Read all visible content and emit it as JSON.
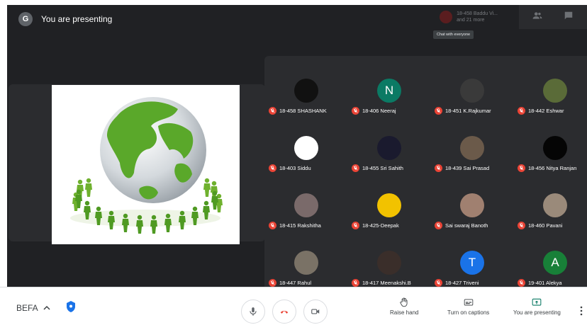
{
  "header": {
    "avatar_letter": "G",
    "title": "You are presenting"
  },
  "presenter_chip": {
    "line1": "18-458 Baddu Vi...",
    "line2": "and 21 more"
  },
  "tooltip": "Chat with everyone",
  "participants": [
    {
      "name": "18-458 SHASHANK",
      "avatar_color": "#111111"
    },
    {
      "name": "18-406 Neeraj",
      "avatar_letter": "N",
      "avatar_color": "#0b7a64"
    },
    {
      "name": "18-451 K.Rajkumar",
      "avatar_color": "#3a3a3a"
    },
    {
      "name": "18-442 Eshwar",
      "avatar_color": "#5a6b38"
    },
    {
      "name": "18-403 Siddu",
      "avatar_color": "#ffffff"
    },
    {
      "name": "18-455 Sri Sahith",
      "avatar_color": "#1a1a2e"
    },
    {
      "name": "18-439 Sai Prasad",
      "avatar_color": "#6b5a4a"
    },
    {
      "name": "18-456 Nitya Ranjan",
      "avatar_color": "#050505"
    },
    {
      "name": "18-415 Rakshitha",
      "avatar_color": "#7a6a6a"
    },
    {
      "name": "18-425-Deepak",
      "avatar_color": "#f2c200"
    },
    {
      "name": "Sai swaraj Banoth",
      "avatar_color": "#a08070"
    },
    {
      "name": "18-460 Pavani",
      "avatar_color": "#9a8a7a"
    },
    {
      "name": "18-447 Rahul",
      "avatar_color": "#7a7266"
    },
    {
      "name": "18-417 Meenakshi.B",
      "avatar_color": "#3a2e2a"
    },
    {
      "name": "18-427 Triveni",
      "avatar_letter": "T",
      "avatar_color": "#1a73e8"
    },
    {
      "name": "19-401 Alekya",
      "avatar_letter": "A",
      "avatar_color": "#188038"
    }
  ],
  "bottom_bar": {
    "meeting_code": "BEFA",
    "actions": [
      {
        "label": "Raise hand"
      },
      {
        "label": "Turn on captions"
      },
      {
        "label": "You are presenting"
      }
    ]
  },
  "colors": {
    "accent_blue": "#1a73e8",
    "red": "#ea4335",
    "dark_bg": "#202124",
    "tile_bg": "#2b2c2f"
  }
}
